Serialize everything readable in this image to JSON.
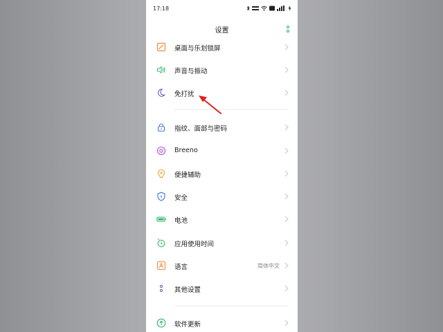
{
  "status_bar": {
    "time": "17:18"
  },
  "header": {
    "title": "设置"
  },
  "settings": [
    {
      "label": "桌面与乐划锁屏",
      "icon": "wallpaper-icon",
      "color": "#f08a3c"
    },
    {
      "label": "声音与振动",
      "icon": "speaker-icon",
      "color": "#3dbb6c"
    },
    {
      "label": "免打扰",
      "icon": "moon-icon",
      "color": "#5b5fc7"
    },
    {
      "label": "指纹、面部与密码",
      "icon": "lock-icon",
      "color": "#4a76d6"
    },
    {
      "label": "Breeno",
      "icon": "breeno-icon",
      "color": "#b04fd6"
    },
    {
      "label": "便捷辅助",
      "icon": "assist-icon",
      "color": "#f0a020"
    },
    {
      "label": "安全",
      "icon": "shield-icon",
      "color": "#3b6ee0"
    },
    {
      "label": "电池",
      "icon": "battery-icon",
      "color": "#2fb36a"
    },
    {
      "label": "应用使用时间",
      "icon": "timer-icon",
      "color": "#3dbb6c"
    },
    {
      "label": "语言",
      "icon": "language-icon",
      "color": "#f08a3c",
      "value": "简体中文"
    },
    {
      "label": "其他设置",
      "icon": "more-settings-icon",
      "color": "#5a6fa8"
    },
    {
      "label": "软件更新",
      "icon": "update-icon",
      "color": "#2fb36a"
    }
  ]
}
